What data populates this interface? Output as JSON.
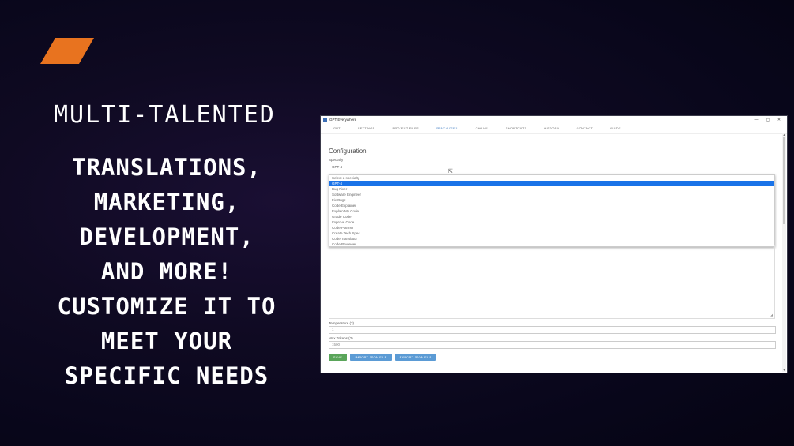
{
  "promo": {
    "subtitle": "MULTI-TALENTED",
    "headline_lines": [
      "TRANSLATIONS,",
      "MARKETING,",
      "DEVELOPMENT,",
      "AND MORE!",
      "CUSTOMIZE IT TO",
      "MEET YOUR",
      "SPECIFIC NEEDS"
    ]
  },
  "colors": {
    "logo_accent": "#e8731f",
    "active_tab": "#4f86c6",
    "selected_option": "#1a73e8",
    "save_button": "#5aa55a",
    "json_buttons": "#5b9bd5"
  },
  "window": {
    "title": "GPT Everywhere",
    "controls": {
      "minimize": "—",
      "maximize": "◻",
      "close": "✕"
    }
  },
  "nav": {
    "tabs": [
      "GPT",
      "SETTINGS",
      "PROJECT FILES",
      "SPECIALTIES",
      "CHAINS",
      "SHORTCUTS",
      "HISTORY",
      "CONTACT",
      "GUIDE"
    ],
    "active": "SPECIALTIES"
  },
  "config": {
    "title": "Configuration",
    "specialty_label": "Specialty",
    "specialty_value": "GPT-4",
    "options": [
      "Select a specialty",
      "GPT-4",
      "Bug Fixer",
      "Software Engineer",
      "Fix Bugs",
      "Code Explainer",
      "Explain My Code",
      "Grade Code",
      "Improve Code",
      "Code Planner",
      "Create Tech Spec",
      "Code Translator",
      "Code Reviewer"
    ],
    "selected_option": "GPT-4",
    "temperature_label": "Temperature (?)",
    "temperature_value": "1",
    "max_tokens_label": "Max Tokens (?)",
    "max_tokens_value": "1500"
  },
  "buttons": {
    "save": "SAVE",
    "import": "IMPORT JSON FILE",
    "export": "EXPORT JSON FILE"
  }
}
